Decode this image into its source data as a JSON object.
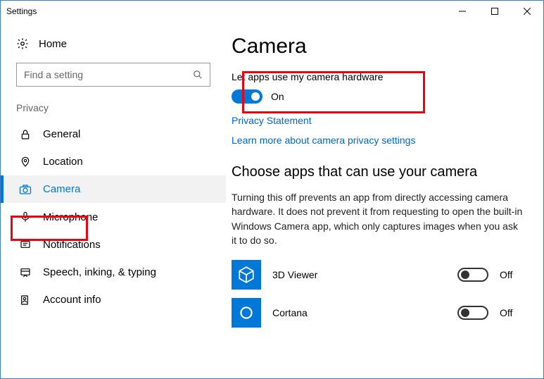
{
  "window": {
    "title": "Settings"
  },
  "sidebar": {
    "home_label": "Home",
    "search_placeholder": "Find a setting",
    "group_label": "Privacy",
    "items": [
      {
        "label": "General"
      },
      {
        "label": "Location"
      },
      {
        "label": "Camera"
      },
      {
        "label": "Microphone"
      },
      {
        "label": "Notifications"
      },
      {
        "label": "Speech, inking, & typing"
      },
      {
        "label": "Account info"
      }
    ],
    "active_index": 2
  },
  "main": {
    "heading": "Camera",
    "master_label": "Let apps use my camera hardware",
    "master_state": "On",
    "links": {
      "privacy": "Privacy Statement",
      "learn_more": "Learn more about camera privacy settings"
    },
    "subheading": "Choose apps that can use your camera",
    "description": "Turning this off prevents an app from directly accessing camera hardware. It does not prevent it from requesting to open the built-in Windows Camera app, which only captures images when you ask it to do so.",
    "apps": [
      {
        "name": "3D Viewer",
        "state": "Off"
      },
      {
        "name": "Cortana",
        "state": "Off"
      }
    ]
  },
  "colors": {
    "accent": "#0078d7",
    "highlight": "#e30613"
  }
}
